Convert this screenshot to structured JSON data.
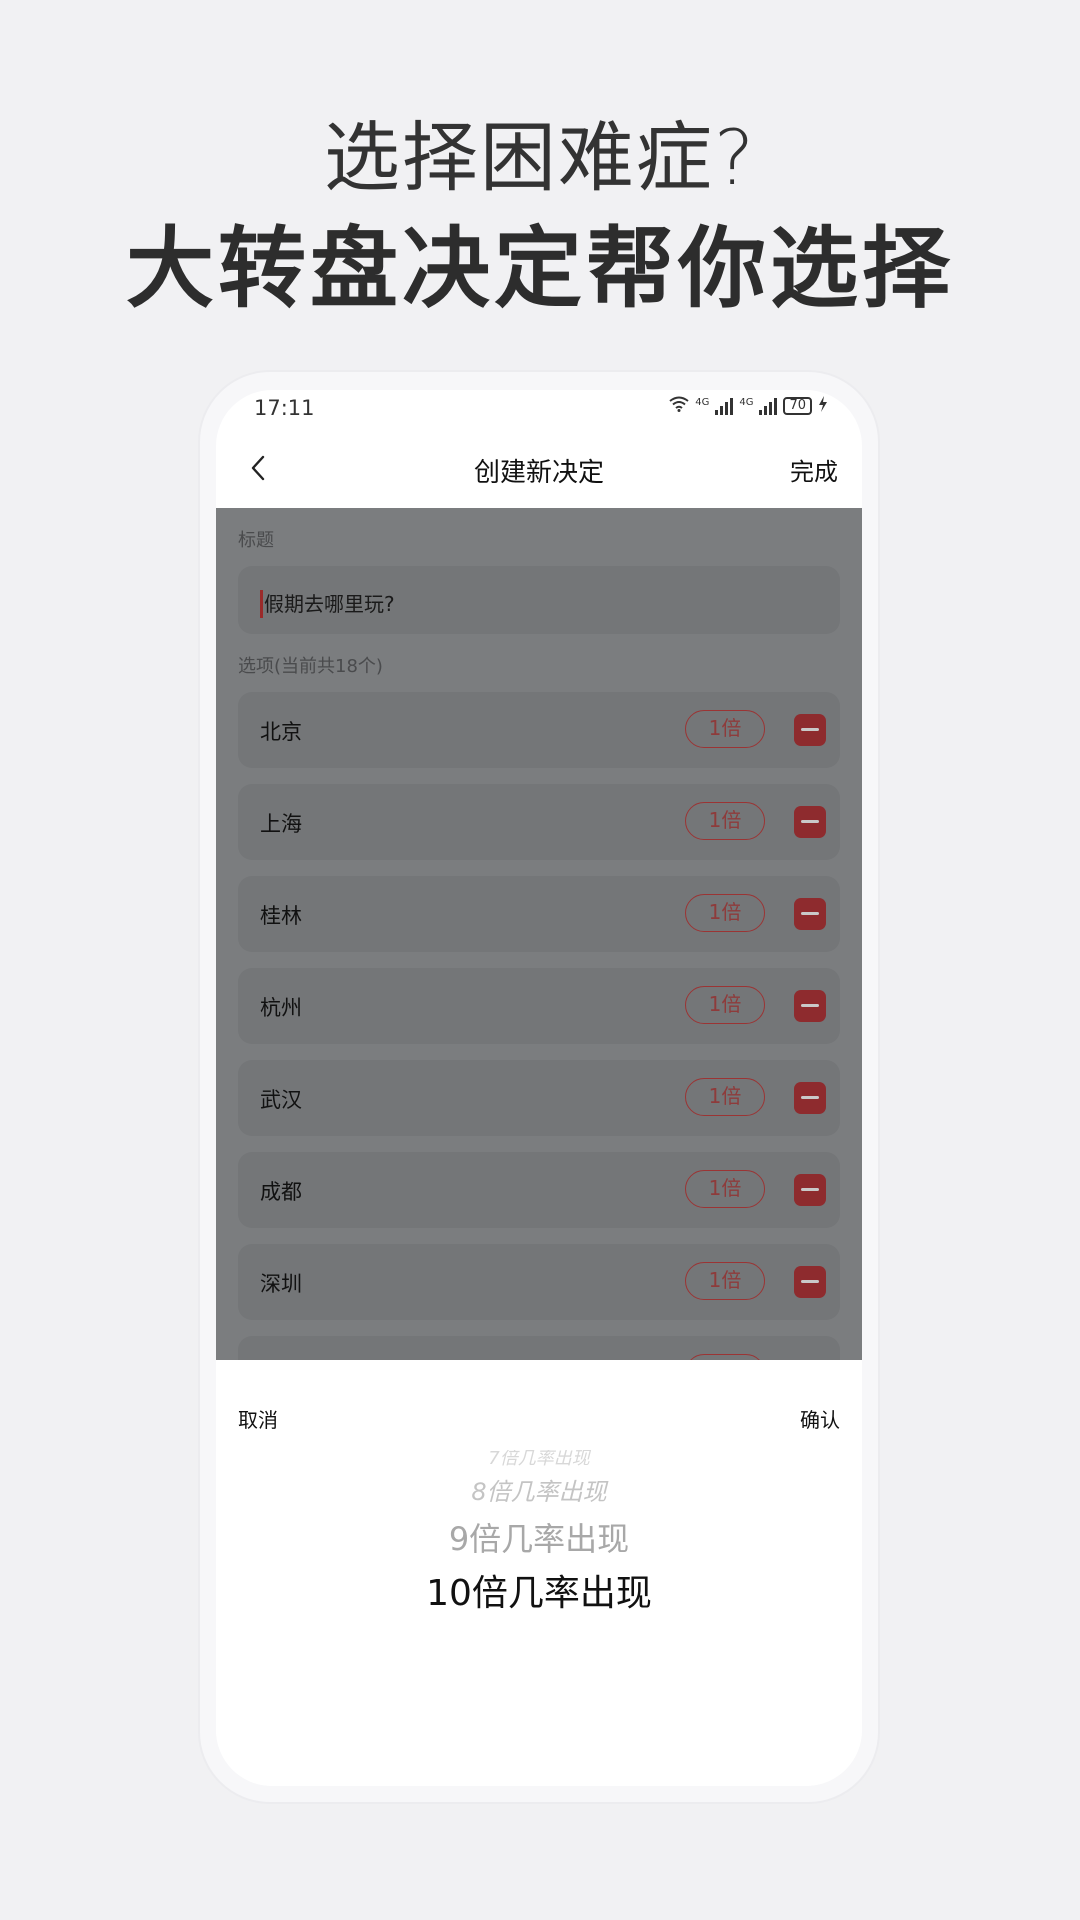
{
  "promo": {
    "line1": "选择困难症?",
    "line2": "大转盘决定帮你选择"
  },
  "status_bar": {
    "time": "17:11",
    "network1": "4G",
    "network2": "4G",
    "battery": "70"
  },
  "nav": {
    "title": "创建新决定",
    "done": "完成"
  },
  "form": {
    "title_label": "标题",
    "title_value": "假期去哪里玩?",
    "options_label": "选项(当前共18个)",
    "options": [
      {
        "name": "北京",
        "weight": "1倍"
      },
      {
        "name": "上海",
        "weight": "1倍"
      },
      {
        "name": "桂林",
        "weight": "1倍"
      },
      {
        "name": "杭州",
        "weight": "1倍"
      },
      {
        "name": "武汉",
        "weight": "1倍"
      },
      {
        "name": "成都",
        "weight": "1倍"
      },
      {
        "name": "深圳",
        "weight": "1倍"
      }
    ]
  },
  "picker": {
    "cancel": "取消",
    "confirm": "确认",
    "items": [
      "7倍几率出现",
      "8倍几率出现",
      "9倍几率出现",
      "10倍几率出现"
    ],
    "selected": "10倍几率出现"
  },
  "colors": {
    "background": "#f1f1f3",
    "overlay": "#7b7d7f",
    "accent_red": "#8e2b2e"
  }
}
